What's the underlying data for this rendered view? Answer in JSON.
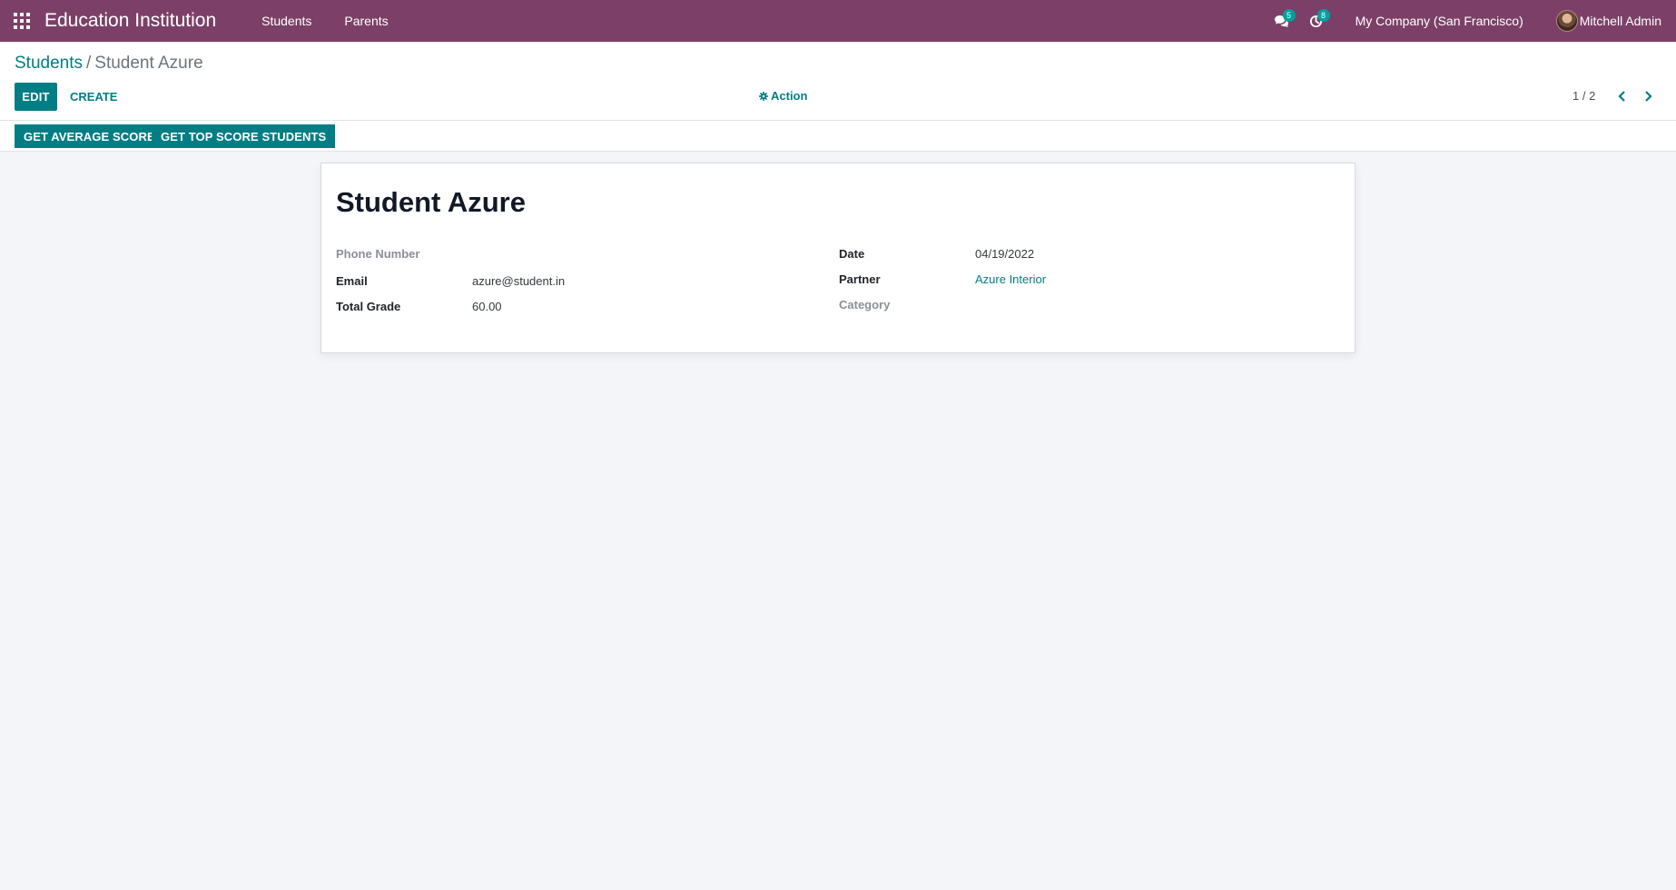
{
  "navbar": {
    "brand": "Education Institution",
    "menu": [
      {
        "label": "Students"
      },
      {
        "label": "Parents"
      }
    ],
    "messages_badge": "5",
    "activities_badge": "8",
    "company": "My Company (San Francisco)",
    "user": "Mitchell Admin",
    "icons": [
      "apps-grid-icon",
      "chat-bubbles-icon",
      "clock-icon",
      "user-avatar"
    ],
    "color": "#7c4068"
  },
  "breadcrumb": {
    "parent": "Students",
    "separator": "/",
    "current": "Student Azure"
  },
  "control": {
    "edit_label": "EDIT",
    "create_label": "CREATE",
    "action_label": "Action",
    "pager": "1 / 2"
  },
  "statusbar": {
    "average_label": "GET AVERAGE SCORE",
    "top_label": "GET TOP SCORE STUDENTS"
  },
  "record": {
    "title": "Student Azure",
    "left_fields": [
      {
        "label": "Phone Number",
        "value": ""
      },
      {
        "label": "Email",
        "value": "azure@student.in"
      },
      {
        "label": "Total Grade",
        "value": "60.00"
      }
    ],
    "right_fields": [
      {
        "label": "Date",
        "value": "04/19/2022"
      },
      {
        "label": "Partner",
        "value": "Azure Interior"
      },
      {
        "label": "Category",
        "value": ""
      }
    ]
  },
  "colors": {
    "primary": "#017e84",
    "navbar": "#7c4068",
    "background": "#f4f5f8"
  }
}
